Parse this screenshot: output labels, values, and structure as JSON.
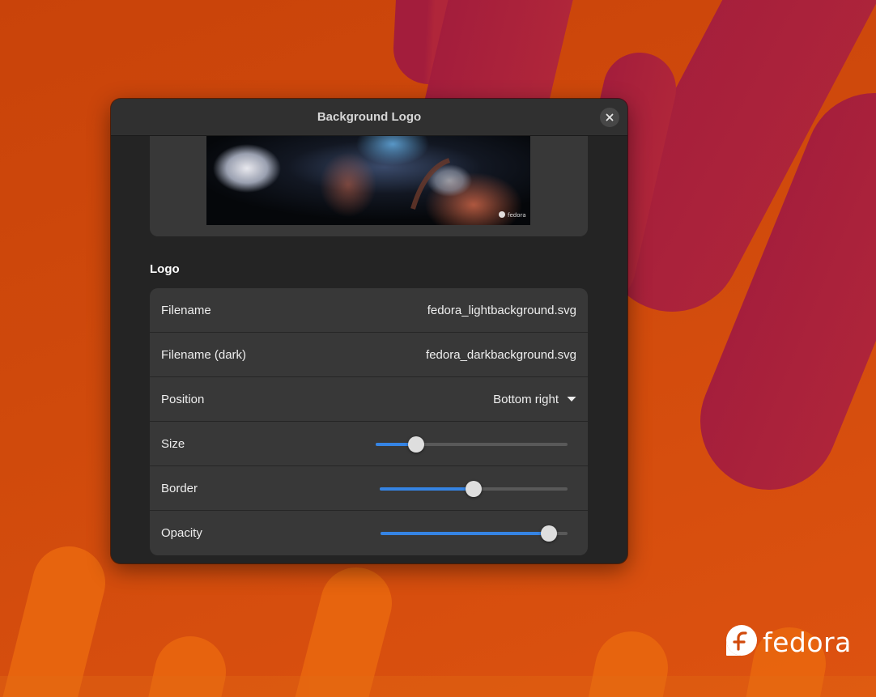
{
  "window": {
    "title": "Background Logo"
  },
  "preview": {
    "watermark_text": "fedora"
  },
  "logo_section": {
    "heading": "Logo",
    "rows": {
      "filename": {
        "label": "Filename",
        "value": "fedora_lightbackground.svg"
      },
      "filename_dark": {
        "label": "Filename (dark)",
        "value": "fedora_darkbackground.svg"
      },
      "position": {
        "label": "Position",
        "value": "Bottom right"
      },
      "size": {
        "label": "Size",
        "level": 0.21
      },
      "border": {
        "label": "Border",
        "level": 0.5
      },
      "opacity": {
        "label": "Opacity",
        "level": 0.9
      }
    }
  },
  "desktop": {
    "brand_text": "fedora"
  },
  "colors": {
    "accent": "#3584e4",
    "wallpaper_orange": "#d04a0c",
    "wallpaper_crimson": "#a8203a",
    "dialog_bg": "#242424"
  },
  "icons": {
    "close": "close-icon",
    "dropdown": "chevron-down-icon",
    "brand": "fedora-logo-icon"
  }
}
